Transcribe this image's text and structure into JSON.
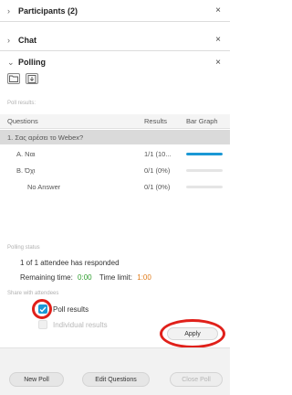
{
  "panels": {
    "participants": {
      "label": "Participants (2)",
      "chevron": "›",
      "close": "×"
    },
    "chat": {
      "label": "Chat",
      "chevron": "›",
      "close": "×"
    },
    "polling": {
      "label": "Polling",
      "chevron": "⌄",
      "close": "×"
    }
  },
  "toolbar": {
    "open_icon": "folder-icon",
    "save_icon": "save-icon"
  },
  "poll_results_label": "Poll results:",
  "table": {
    "headers": {
      "question": "Questions",
      "results": "Results",
      "bar": "Bar Graph"
    },
    "question": "1. Σας αρέσει το Webex?",
    "answers": [
      {
        "label": "A.  Ναι",
        "result": "1/1 (10...",
        "fraction": 1.0
      },
      {
        "label": "B.  Όχι",
        "result": "0/1 (0%)",
        "fraction": 0.0
      },
      {
        "label": "No Answer",
        "result": "0/1 (0%)",
        "fraction": 0.0
      }
    ],
    "bar_color": "#1a98d5"
  },
  "status": {
    "label": "Polling status",
    "responded": "1  of  1  attendee has responded",
    "remaining_label": "Remaining time:",
    "remaining_value": "0:00",
    "limit_label": "Time limit:",
    "limit_value": "1:00"
  },
  "share": {
    "label": "Share with attendees",
    "poll_results": "Poll results",
    "individual_results": "Individual results",
    "poll_results_checked": true,
    "individual_results_checked": false
  },
  "buttons": {
    "apply": "Apply",
    "new_poll": "New Poll",
    "edit_questions": "Edit Questions",
    "close_poll": "Close Poll"
  },
  "colors": {
    "accent": "#1a98d5",
    "highlight": "#e0201a",
    "green": "#2e9e2e",
    "orange": "#e07b1a"
  }
}
